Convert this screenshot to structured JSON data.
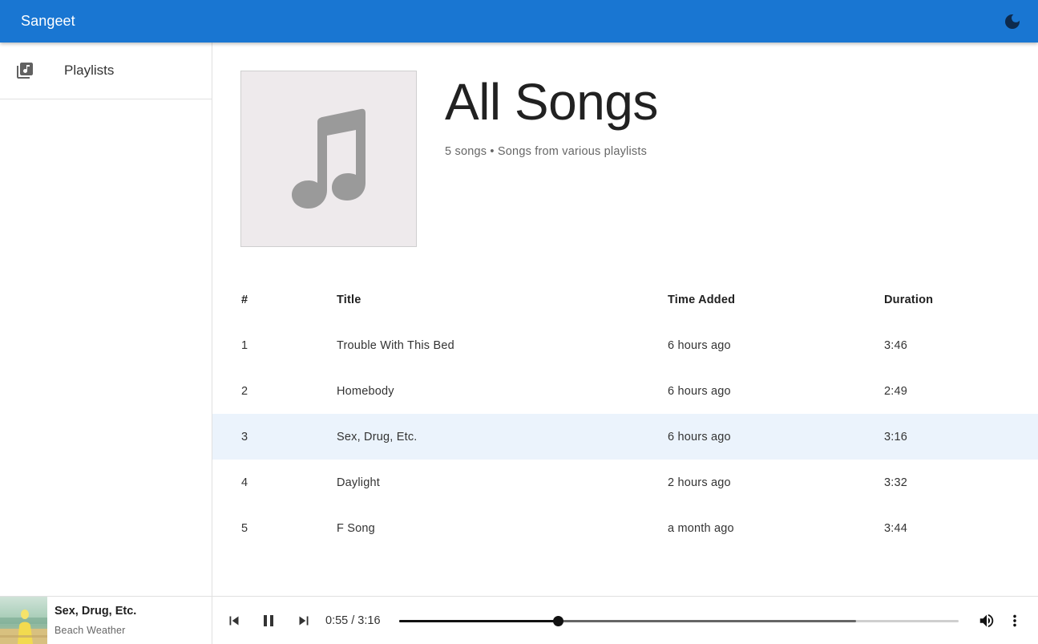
{
  "app": {
    "title": "Sangeet",
    "accent": "#1976d2"
  },
  "sidebar": {
    "items": [
      {
        "label": "Playlists",
        "icon": "library-music-icon"
      }
    ]
  },
  "playlist": {
    "heading": "All Songs",
    "subtitle": "5 songs • Songs from various playlists",
    "cover_icon": "music-note-icon"
  },
  "table": {
    "headers": {
      "num": "#",
      "title": "Title",
      "time_added": "Time Added",
      "duration": "Duration"
    },
    "rows": [
      {
        "num": "1",
        "title": "Trouble With This Bed",
        "time_added": "6 hours ago",
        "duration": "3:46"
      },
      {
        "num": "2",
        "title": "Homebody",
        "time_added": "6 hours ago",
        "duration": "2:49"
      },
      {
        "num": "3",
        "title": "Sex, Drug, Etc.",
        "time_added": "6 hours ago",
        "duration": "3:16"
      },
      {
        "num": "4",
        "title": "Daylight",
        "time_added": "2 hours ago",
        "duration": "3:32"
      },
      {
        "num": "5",
        "title": "F Song",
        "time_added": "a month ago",
        "duration": "3:44"
      }
    ],
    "active_row": 2,
    "active_row_color": "#ebf3fc"
  },
  "player": {
    "track_title": "Sex, Drug, Etc.",
    "artist": "Beach Weather",
    "time_display": "0:55 / 3:16",
    "progress_fraction": 0.284,
    "buffered_fraction": 0.816,
    "icons": [
      "skip-previous-icon",
      "pause-icon",
      "skip-next-icon",
      "volume-icon",
      "more-vert-icon"
    ]
  }
}
